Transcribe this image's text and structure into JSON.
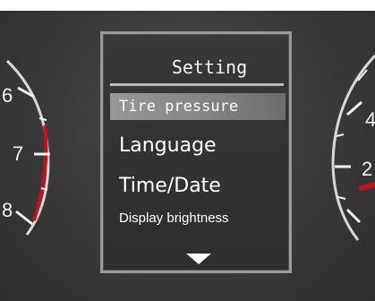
{
  "menu": {
    "title": "Setting",
    "items": [
      {
        "label": "Tire pressure",
        "selected": true
      },
      {
        "label": "Language",
        "selected": false
      },
      {
        "label": "Time/Date",
        "selected": false
      },
      {
        "label": "Display brightness",
        "selected": false
      }
    ],
    "scroll_icon": "triangle-down-icon"
  },
  "gauges": {
    "left": {
      "labels": [
        "6",
        "7",
        "8"
      ]
    },
    "right": {
      "labels": [
        "4",
        "2"
      ]
    }
  },
  "colors": {
    "background": "#3d3b3b",
    "panel_border": "#9a9a9a",
    "selected_row": "#8e8c8a",
    "gauge_red": "#c0141c",
    "gauge_white": "#f2f2f2",
    "text": "#ffffff"
  }
}
